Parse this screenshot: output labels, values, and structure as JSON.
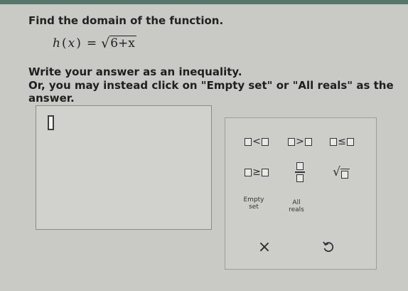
{
  "question": {
    "prompt": "Find the domain of the function.",
    "function_name": "h",
    "variable": "x",
    "equals": "=",
    "radicand": "6+x",
    "instruction_line1": "Write your answer as an inequality.",
    "instruction_line2": "Or, you may instead click on \"Empty set\" or \"All reals\" as the answer."
  },
  "keypad": {
    "less_than": "<",
    "greater_than": ">",
    "less_equal": "≤",
    "greater_equal": "≥",
    "empty_set_line1": "Empty",
    "empty_set_line2": "set",
    "all_reals_line1": "All",
    "all_reals_line2": "reals",
    "clear_label": "×"
  }
}
